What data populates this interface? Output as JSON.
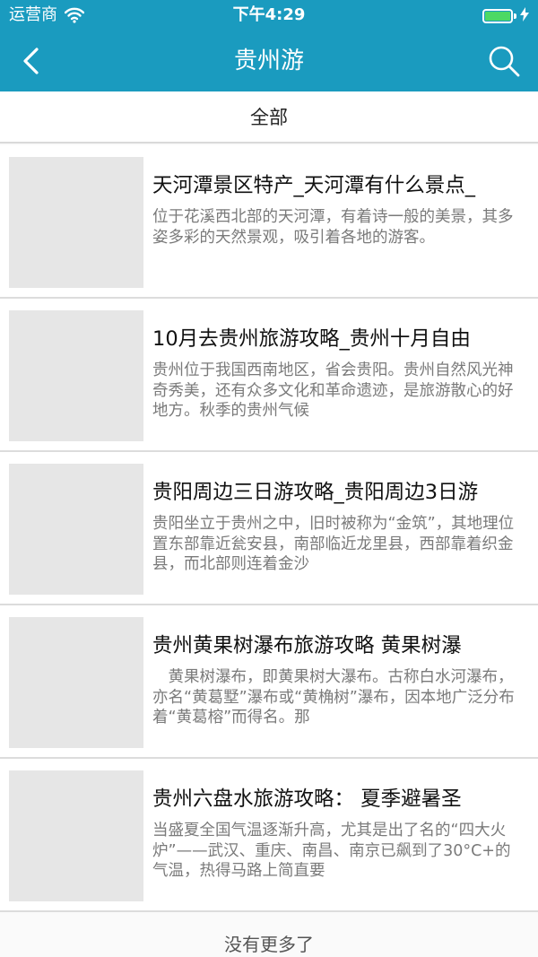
{
  "status_bar": {
    "carrier": "运营商",
    "time": "下午4:29",
    "battery_level": 1.0,
    "battery_color": "#4cd964"
  },
  "nav": {
    "title": "贵州游",
    "back_icon": "chevron-left-icon",
    "search_icon": "search-icon",
    "background": "#1a9bbf"
  },
  "filter": {
    "label": "全部"
  },
  "items": [
    {
      "title": "天河潭景区特产_天河潭有什么景点_",
      "desc": "位于花溪西北部的天河潭，有着诗一般的美景，其多姿多彩的天然景观，吸引着各地的游客。"
    },
    {
      "title": "10月去贵州旅游攻略_贵州十月自由",
      "desc": "贵州位于我国西南地区，省会贵阳。贵州自然风光神奇秀美，还有众多文化和革命遗迹，是旅游散心的好地方。秋季的贵州气候"
    },
    {
      "title": "贵阳周边三日游攻略_贵阳周边3日游",
      "desc": "贵阳坐立于贵州之中，旧时被称为“金筑”，其地理位置东部靠近瓮安县，南部临近龙里县，西部靠着织金县，而北部则连着金沙"
    },
    {
      "title": "贵州黄果树瀑布旅游攻略 黄果树瀑",
      "desc": "　黄果树瀑布，即黄果树大瀑布。古称白水河瀑布，亦名“黄葛墅”瀑布或“黄桷树”瀑布，因本地广泛分布着“黄葛榕”而得名。那"
    },
    {
      "title": "贵州六盘水旅游攻略：  夏季避暑圣",
      "desc": "当盛夏全国气温逐渐升高，尤其是出了名的“四大火炉”——武汉、重庆、南昌、南京已飙到了30°C+的气温，热得马路上简直要"
    }
  ],
  "footer": {
    "text": "没有更多了"
  }
}
